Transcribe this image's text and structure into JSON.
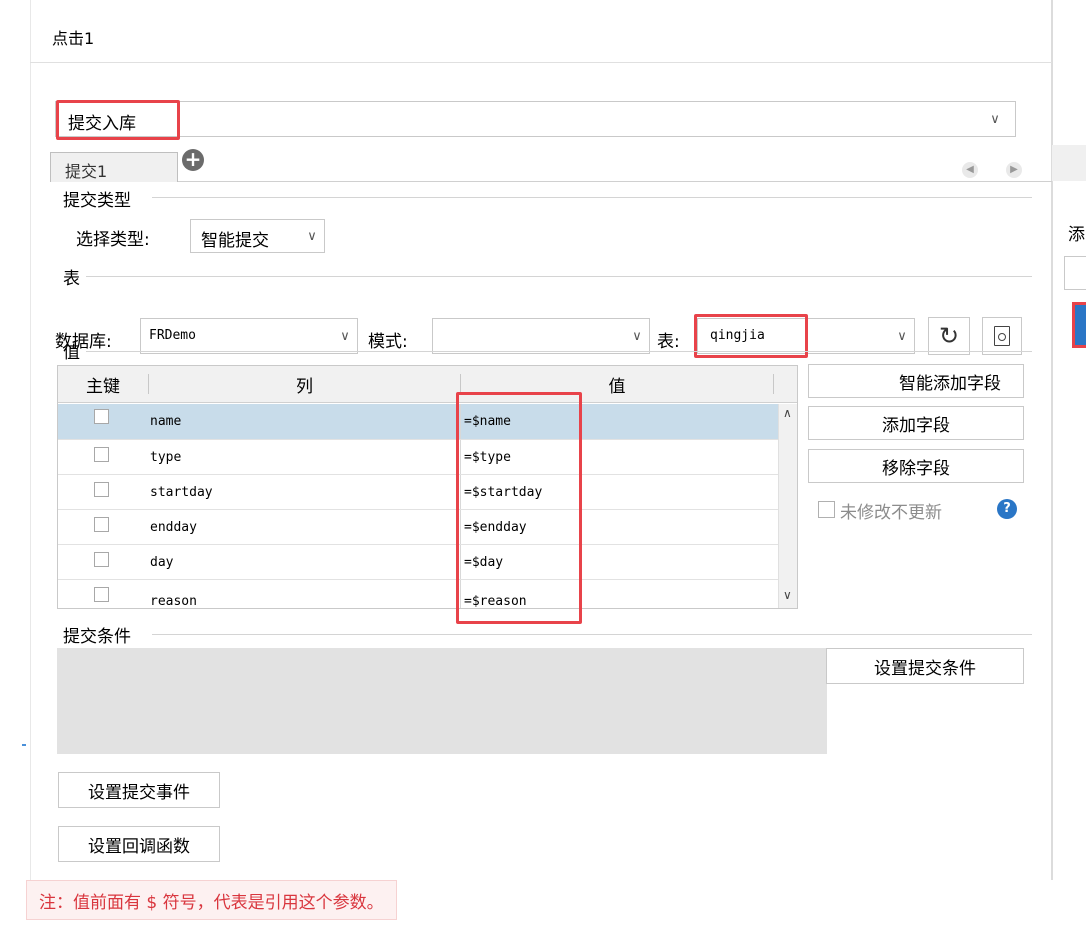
{
  "dialog": {
    "title": "点击1"
  },
  "event_select": {
    "value": "提交入库"
  },
  "tabs": {
    "active": "提交1"
  },
  "submit_type": {
    "section": "提交类型",
    "label": "选择类型:",
    "value": "智能提交"
  },
  "table_section": {
    "section": "表",
    "db_label": "数据库:",
    "db_value": "FRDemo",
    "schema_label": "模式:",
    "schema_value": "",
    "table_label": "表:",
    "table_value": "qingjia"
  },
  "values": {
    "section": "值",
    "headers": [
      "主键",
      "列",
      "值"
    ],
    "rows": [
      {
        "col": "name",
        "val": "=$name"
      },
      {
        "col": "type",
        "val": "=$type"
      },
      {
        "col": "startday",
        "val": "=$startday"
      },
      {
        "col": "endday",
        "val": "=$endday"
      },
      {
        "col": "day",
        "val": "=$day"
      },
      {
        "col": "reason",
        "val": "=$reason"
      }
    ]
  },
  "side_buttons": {
    "smart_add": "智能添加字段",
    "add": "添加字段",
    "remove": "移除字段",
    "no_update": "未修改不更新"
  },
  "condition": {
    "section": "提交条件",
    "set_btn": "设置提交条件"
  },
  "bottom_buttons": {
    "set_event": "设置提交事件",
    "set_callback": "设置回调函数"
  },
  "right_panel": {
    "partial_label": "添"
  },
  "note": "注：值前面有 $ 符号，代表是引用这个参数。",
  "colors": {
    "highlight": "#e8434a",
    "row_selected": "#c8dcea",
    "note_text": "#d9363e"
  }
}
